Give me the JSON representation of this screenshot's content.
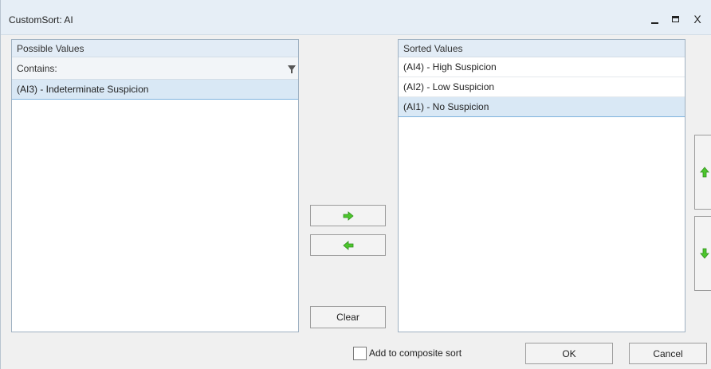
{
  "window": {
    "title": "CustomSort: AI",
    "close_label": "X"
  },
  "possible": {
    "header": "Possible Values",
    "filter_label": "Contains:",
    "items": [
      {
        "label": "(AI3) - Indeterminate Suspicion",
        "selected": true
      }
    ]
  },
  "sorted": {
    "header": "Sorted Values",
    "items": [
      {
        "label": "(AI4) - High Suspicion",
        "selected": false
      },
      {
        "label": "(AI2) - Low Suspicion",
        "selected": false
      },
      {
        "label": "(AI1) - No Suspicion",
        "selected": true
      }
    ]
  },
  "buttons": {
    "clear": "Clear",
    "ok": "OK",
    "cancel": "Cancel"
  },
  "composite": {
    "label": "Add to composite sort",
    "checked": false
  },
  "colors": {
    "arrow_green": "#4cc62c",
    "arrow_dark_green": "#2f8f1c",
    "selection": "#d9e8f5"
  },
  "icons": {
    "move_right": "arrow-right-icon",
    "move_left": "arrow-left-icon",
    "move_up": "arrow-up-icon",
    "move_down": "arrow-down-icon",
    "filter": "filter-icon"
  }
}
